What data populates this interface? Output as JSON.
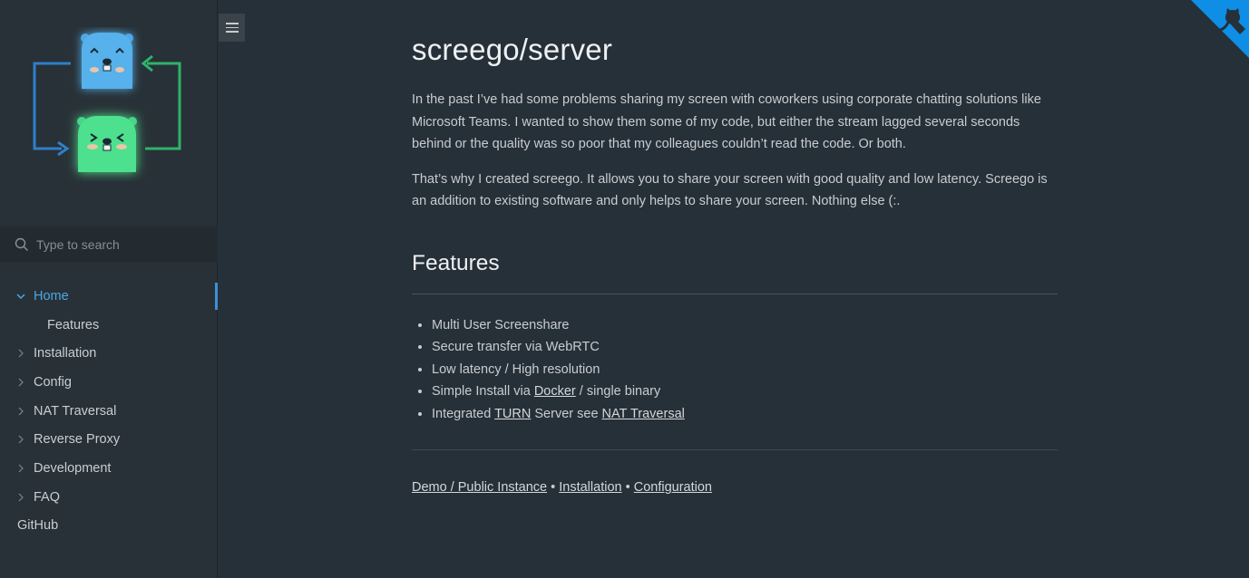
{
  "search": {
    "placeholder": "Type to search"
  },
  "nav": [
    {
      "label": "Home",
      "active": true,
      "expanded": true
    },
    {
      "label": "Features",
      "sub": true
    },
    {
      "label": "Installation"
    },
    {
      "label": "Config"
    },
    {
      "label": "NAT Traversal"
    },
    {
      "label": "Reverse Proxy"
    },
    {
      "label": "Development"
    },
    {
      "label": "FAQ"
    },
    {
      "label": "GitHub",
      "plain": true
    }
  ],
  "page": {
    "title": "screego/server",
    "intro_1": "In the past I’ve had some problems sharing my screen with coworkers using corporate chatting solutions like Microsoft Teams. I wanted to show them some of my code, but either the stream lagged several seconds behind or the quality was so poor that my colleagues couldn’t read the code. Or both.",
    "intro_2": "That’s why I created screego. It allows you to share your screen with good quality and low latency. Screego is an addition to existing software and only helps to share your screen. Nothing else (:.",
    "features_heading": "Features",
    "features": {
      "f1": "Multi User Screenshare",
      "f2": "Secure transfer via WebRTC",
      "f3": "Low latency / High resolution",
      "f4_pre": "Simple Install via ",
      "f4_link": "Docker",
      "f4_post": " / single binary",
      "f5_pre": "Integrated ",
      "f5_link1": "TURN",
      "f5_mid": " Server see ",
      "f5_link2": "NAT Traversal"
    },
    "footer": {
      "link1": "Demo / Public Instance",
      "sep1": " • ",
      "link2": "Installation",
      "sep2": " • ",
      "link3": "Configuration"
    }
  },
  "colors": {
    "background": "#263038",
    "sidebar": "#283137",
    "accent": "#4ba7e8",
    "corner": "#0f8ee5"
  },
  "icons": {
    "search": "search-icon",
    "menu": "hamburger-icon",
    "chevron": "chevron-icon",
    "github": "github-icon",
    "logo": "screego-gopher-logo"
  }
}
